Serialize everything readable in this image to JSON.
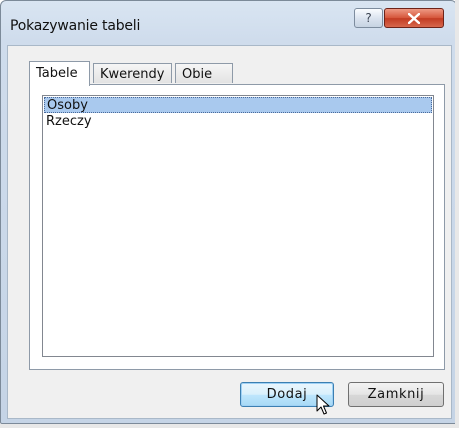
{
  "window": {
    "title": "Pokazywanie tabeli",
    "help_label": "?",
    "close_label": "X"
  },
  "tabs": [
    {
      "label": "Tabele",
      "active": true
    },
    {
      "label": "Kwerendy",
      "active": false
    },
    {
      "label": "Obie",
      "active": false
    }
  ],
  "list": {
    "items": [
      {
        "label": "Osoby",
        "selected": true
      },
      {
        "label": "Rzeczy",
        "selected": false
      }
    ]
  },
  "buttons": {
    "add_label": "Dodaj",
    "close_label": "Zamknij"
  },
  "colors": {
    "selection": "#a9c9ee",
    "close_button": "#c23b22",
    "default_button_border": "#3c7fb1"
  }
}
